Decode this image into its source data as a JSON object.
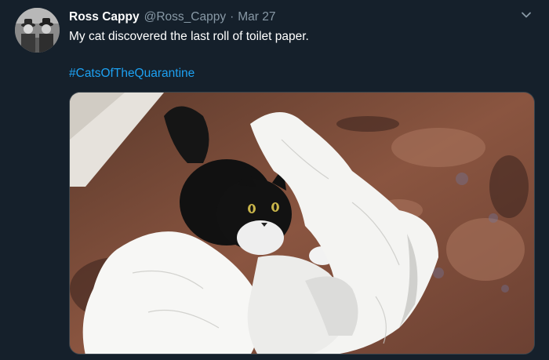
{
  "tweet": {
    "display_name": "Ross Cappy",
    "handle": "@Ross_Cappy",
    "separator": "·",
    "date": "Mar 27",
    "text": "My cat discovered the last roll of toilet paper.",
    "hashtag": "#CatsOfTheQuarantine"
  },
  "icons": {
    "caret": "chevron-down-icon"
  },
  "colors": {
    "background": "#15202b",
    "primary_text": "#ffffff",
    "secondary_text": "#8899a6",
    "link": "#1da1f2"
  }
}
